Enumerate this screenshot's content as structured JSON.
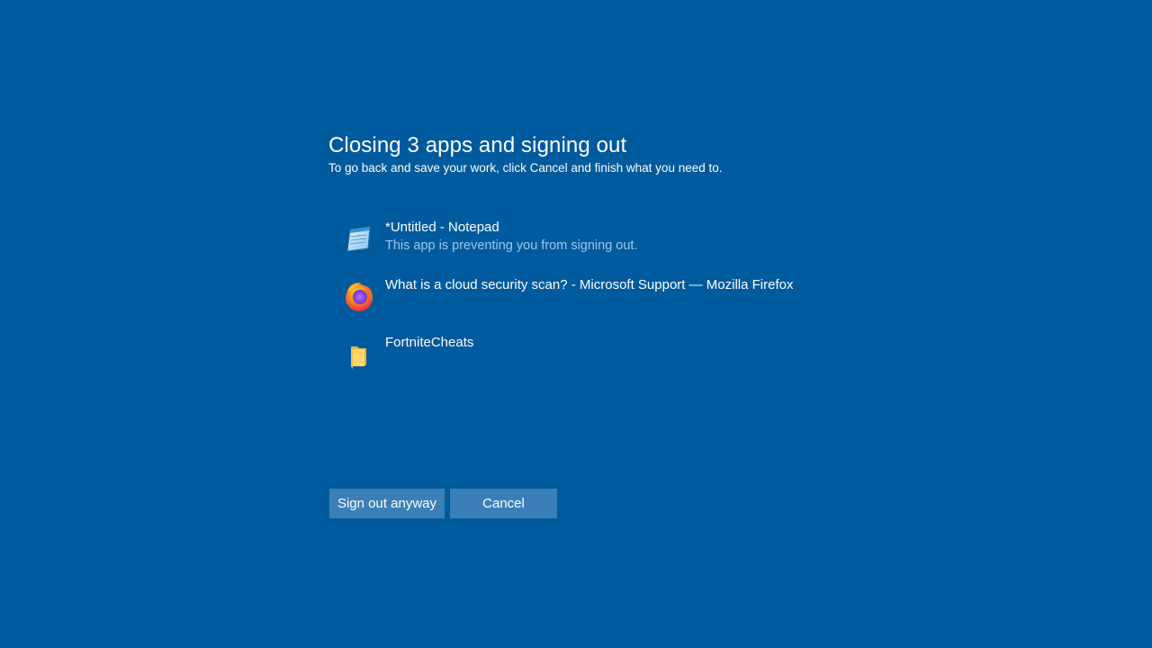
{
  "dialog": {
    "title": "Closing 3 apps and signing out",
    "subtitle": "To go back and save your work, click Cancel and finish what you need to."
  },
  "apps": [
    {
      "icon": "notepad-icon",
      "name": "*Untitled - Notepad",
      "status": "This app is preventing you from signing out."
    },
    {
      "icon": "firefox-icon",
      "name": "What is a cloud security scan? - Microsoft Support — Mozilla Firefox",
      "status": ""
    },
    {
      "icon": "folder-icon",
      "name": "FortniteCheats",
      "status": ""
    }
  ],
  "buttons": {
    "sign_out": "Sign out anyway",
    "cancel": "Cancel"
  },
  "colors": {
    "background": "#005a9e",
    "button": "#3c7fb8",
    "status_text": "#9bc8ee"
  }
}
